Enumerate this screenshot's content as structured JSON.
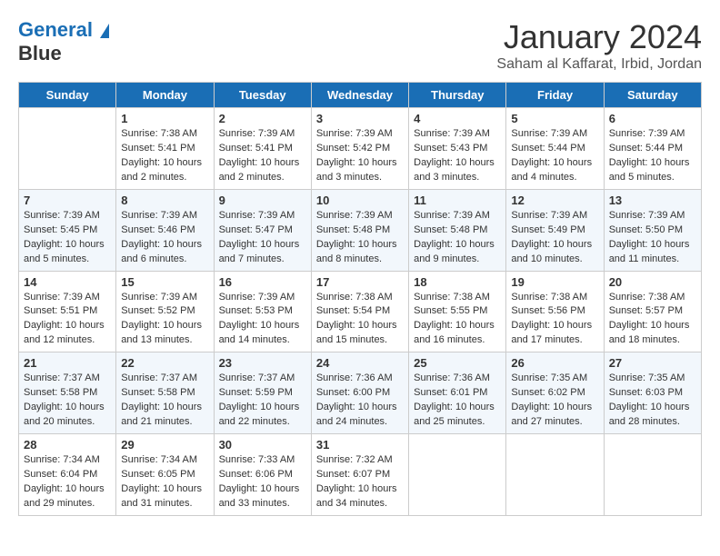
{
  "header": {
    "logo_line1": "General",
    "logo_line2": "Blue",
    "month": "January 2024",
    "location": "Saham al Kaffarat, Irbid, Jordan"
  },
  "weekdays": [
    "Sunday",
    "Monday",
    "Tuesday",
    "Wednesday",
    "Thursday",
    "Friday",
    "Saturday"
  ],
  "weeks": [
    [
      {
        "day": "",
        "info": ""
      },
      {
        "day": "1",
        "info": "Sunrise: 7:38 AM\nSunset: 5:41 PM\nDaylight: 10 hours\nand 2 minutes."
      },
      {
        "day": "2",
        "info": "Sunrise: 7:39 AM\nSunset: 5:41 PM\nDaylight: 10 hours\nand 2 minutes."
      },
      {
        "day": "3",
        "info": "Sunrise: 7:39 AM\nSunset: 5:42 PM\nDaylight: 10 hours\nand 3 minutes."
      },
      {
        "day": "4",
        "info": "Sunrise: 7:39 AM\nSunset: 5:43 PM\nDaylight: 10 hours\nand 3 minutes."
      },
      {
        "day": "5",
        "info": "Sunrise: 7:39 AM\nSunset: 5:44 PM\nDaylight: 10 hours\nand 4 minutes."
      },
      {
        "day": "6",
        "info": "Sunrise: 7:39 AM\nSunset: 5:44 PM\nDaylight: 10 hours\nand 5 minutes."
      }
    ],
    [
      {
        "day": "7",
        "info": "Sunrise: 7:39 AM\nSunset: 5:45 PM\nDaylight: 10 hours\nand 5 minutes."
      },
      {
        "day": "8",
        "info": "Sunrise: 7:39 AM\nSunset: 5:46 PM\nDaylight: 10 hours\nand 6 minutes."
      },
      {
        "day": "9",
        "info": "Sunrise: 7:39 AM\nSunset: 5:47 PM\nDaylight: 10 hours\nand 7 minutes."
      },
      {
        "day": "10",
        "info": "Sunrise: 7:39 AM\nSunset: 5:48 PM\nDaylight: 10 hours\nand 8 minutes."
      },
      {
        "day": "11",
        "info": "Sunrise: 7:39 AM\nSunset: 5:48 PM\nDaylight: 10 hours\nand 9 minutes."
      },
      {
        "day": "12",
        "info": "Sunrise: 7:39 AM\nSunset: 5:49 PM\nDaylight: 10 hours\nand 10 minutes."
      },
      {
        "day": "13",
        "info": "Sunrise: 7:39 AM\nSunset: 5:50 PM\nDaylight: 10 hours\nand 11 minutes."
      }
    ],
    [
      {
        "day": "14",
        "info": "Sunrise: 7:39 AM\nSunset: 5:51 PM\nDaylight: 10 hours\nand 12 minutes."
      },
      {
        "day": "15",
        "info": "Sunrise: 7:39 AM\nSunset: 5:52 PM\nDaylight: 10 hours\nand 13 minutes."
      },
      {
        "day": "16",
        "info": "Sunrise: 7:39 AM\nSunset: 5:53 PM\nDaylight: 10 hours\nand 14 minutes."
      },
      {
        "day": "17",
        "info": "Sunrise: 7:38 AM\nSunset: 5:54 PM\nDaylight: 10 hours\nand 15 minutes."
      },
      {
        "day": "18",
        "info": "Sunrise: 7:38 AM\nSunset: 5:55 PM\nDaylight: 10 hours\nand 16 minutes."
      },
      {
        "day": "19",
        "info": "Sunrise: 7:38 AM\nSunset: 5:56 PM\nDaylight: 10 hours\nand 17 minutes."
      },
      {
        "day": "20",
        "info": "Sunrise: 7:38 AM\nSunset: 5:57 PM\nDaylight: 10 hours\nand 18 minutes."
      }
    ],
    [
      {
        "day": "21",
        "info": "Sunrise: 7:37 AM\nSunset: 5:58 PM\nDaylight: 10 hours\nand 20 minutes."
      },
      {
        "day": "22",
        "info": "Sunrise: 7:37 AM\nSunset: 5:58 PM\nDaylight: 10 hours\nand 21 minutes."
      },
      {
        "day": "23",
        "info": "Sunrise: 7:37 AM\nSunset: 5:59 PM\nDaylight: 10 hours\nand 22 minutes."
      },
      {
        "day": "24",
        "info": "Sunrise: 7:36 AM\nSunset: 6:00 PM\nDaylight: 10 hours\nand 24 minutes."
      },
      {
        "day": "25",
        "info": "Sunrise: 7:36 AM\nSunset: 6:01 PM\nDaylight: 10 hours\nand 25 minutes."
      },
      {
        "day": "26",
        "info": "Sunrise: 7:35 AM\nSunset: 6:02 PM\nDaylight: 10 hours\nand 27 minutes."
      },
      {
        "day": "27",
        "info": "Sunrise: 7:35 AM\nSunset: 6:03 PM\nDaylight: 10 hours\nand 28 minutes."
      }
    ],
    [
      {
        "day": "28",
        "info": "Sunrise: 7:34 AM\nSunset: 6:04 PM\nDaylight: 10 hours\nand 29 minutes."
      },
      {
        "day": "29",
        "info": "Sunrise: 7:34 AM\nSunset: 6:05 PM\nDaylight: 10 hours\nand 31 minutes."
      },
      {
        "day": "30",
        "info": "Sunrise: 7:33 AM\nSunset: 6:06 PM\nDaylight: 10 hours\nand 33 minutes."
      },
      {
        "day": "31",
        "info": "Sunrise: 7:32 AM\nSunset: 6:07 PM\nDaylight: 10 hours\nand 34 minutes."
      },
      {
        "day": "",
        "info": ""
      },
      {
        "day": "",
        "info": ""
      },
      {
        "day": "",
        "info": ""
      }
    ]
  ]
}
